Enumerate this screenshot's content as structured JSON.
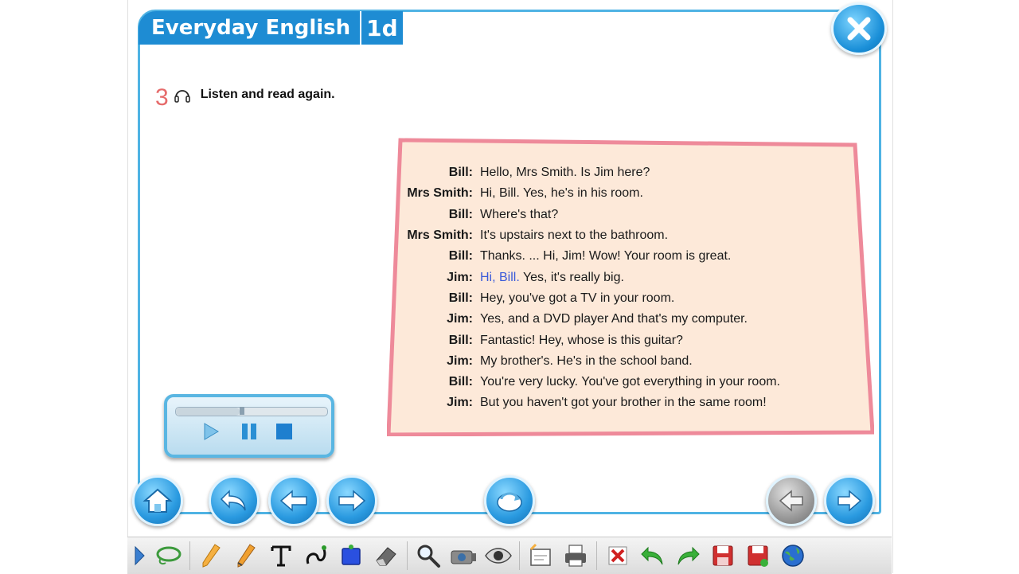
{
  "header": {
    "title": "Everyday English",
    "unit_code": "1d"
  },
  "exercise": {
    "number": "3",
    "instruction": "Listen and read again."
  },
  "dialogue": [
    {
      "speaker": "Bill:",
      "text": "Hello, Mrs Smith. Is Jim here?"
    },
    {
      "speaker": "Mrs Smith:",
      "text": "Hi, Bill. Yes, he's in his room."
    },
    {
      "speaker": "Bill:",
      "text": "Where's that?"
    },
    {
      "speaker": "Mrs Smith:",
      "text": "It's upstairs next to the bathroom."
    },
    {
      "speaker": "Bill:",
      "text": "Thanks. ... Hi, Jim! Wow! Your room is great."
    },
    {
      "speaker": "Jim:",
      "text_highlight": "Hi, Bill.",
      "text": " Yes, it's really big."
    },
    {
      "speaker": "Bill:",
      "text": "Hey, you've got a TV in your room."
    },
    {
      "speaker": "Jim:",
      "text": "Yes, and a DVD player And that's my computer."
    },
    {
      "speaker": "Bill:",
      "text": "Fantastic! Hey, whose is this guitar?"
    },
    {
      "speaker": "Jim:",
      "text": "My brother's. He's in the school band."
    },
    {
      "speaker": "Bill:",
      "text": "You're very lucky. You've got everything in your room."
    },
    {
      "speaker": "Jim:",
      "text": "But you haven't got your brother in the same room!"
    }
  ],
  "player": {
    "progress_fraction": 0.42
  },
  "colors": {
    "accent_blue": "#1e8cd3",
    "frame_blue": "#4fb3e4",
    "dialog_border": "#ee8a9a",
    "dialog_fill": "#fde9d9",
    "exercise_number": "#e66b6b",
    "highlight_text": "#3a5ad9"
  },
  "icons": {
    "close": "close-icon",
    "headphones": "headphones-icon",
    "nav": [
      "home-icon",
      "undo-icon",
      "previous-icon",
      "next-icon",
      "refresh-icon",
      "page-back-icon",
      "page-forward-icon"
    ],
    "toolbar": [
      "expand-arrow-icon",
      "lasso-icon",
      "highlighter-icon",
      "pen-icon",
      "text-icon",
      "curve-icon",
      "shape-icon",
      "eraser-icon",
      "zoom-icon",
      "camera-icon",
      "eye-icon",
      "note-icon",
      "print-icon",
      "delete-icon",
      "undo-icon",
      "redo-icon",
      "save-icon",
      "save-as-icon",
      "globe-icon"
    ]
  }
}
